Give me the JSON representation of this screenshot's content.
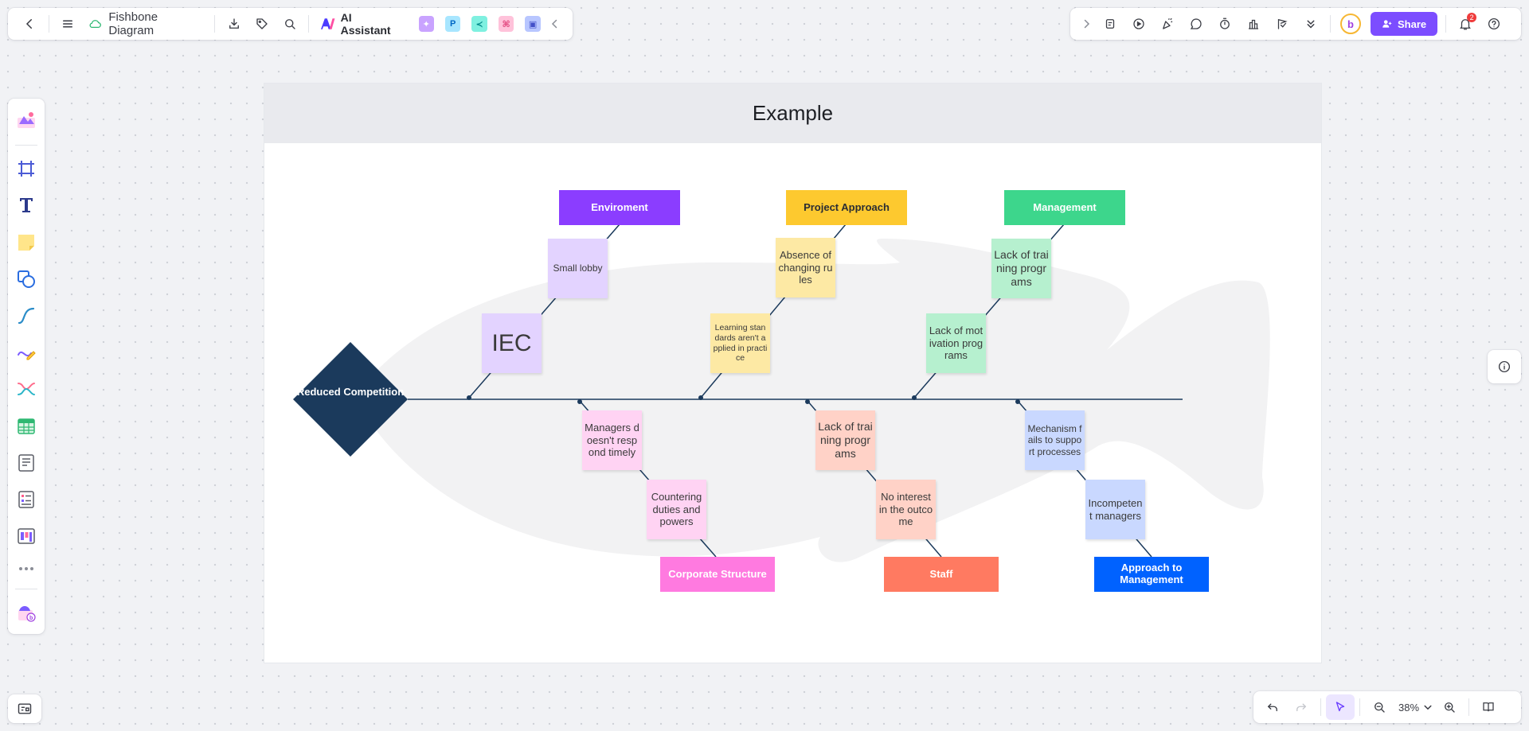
{
  "app": {
    "document_title": "Fishbone Diagram",
    "ai_assistant_label": "AI Assistant",
    "share_label": "Share",
    "notification_count": "2",
    "zoom_level": "38%",
    "accent_color": "#7c4dff"
  },
  "board": {
    "title": "Example",
    "head_label": "Reduced Competition",
    "head_color": "#1b3a5c",
    "categories_top": [
      {
        "label": "Enviroment",
        "color": "#8b3dff"
      },
      {
        "label": "Project Approach",
        "color": "#fdc92f"
      },
      {
        "label": "Management",
        "color": "#3dd68c"
      }
    ],
    "categories_bottom": [
      {
        "label": "Corporate Structure",
        "color": "#ff7ae0"
      },
      {
        "label": "Staff",
        "color": "#ff7a61"
      },
      {
        "label": "Approach to Management",
        "color": "#0062ff"
      }
    ],
    "stickies": {
      "env_1": "Small lobby",
      "env_2": "IEC",
      "proj_1": "Absence of changing rules",
      "proj_2": "Learning standards aren't applied in practice",
      "mgmt_1": "Lack of training programs",
      "mgmt_2": "Lack of motivation programs",
      "corp_1": "Managers doesn't respond timely",
      "corp_2": "Countering duties and powers",
      "staff_1": "Lack of training programs",
      "staff_2": "No interest in the outcome",
      "appr_1": "Mechanism fails to support processes",
      "appr_2": "Incompetent managers"
    }
  },
  "icons": {
    "topbar_left": [
      "back-icon",
      "menu-icon",
      "cloud-sync-icon",
      "download-icon",
      "tag-icon",
      "search-icon"
    ],
    "topbar_right": [
      "expand-icon",
      "sticker-icon",
      "play-icon",
      "celebrate-icon",
      "comment-icon",
      "timer-icon",
      "vote-icon",
      "flag-icon",
      "more-down-icon",
      "bell-icon",
      "help-icon"
    ],
    "left_toolbar": [
      "templates-icon",
      "frame-icon",
      "text-icon",
      "sticky-note-icon",
      "shape-icon",
      "connector-icon",
      "pen-icon",
      "mindmap-icon",
      "table-icon",
      "document-icon",
      "list-icon",
      "kanban-icon",
      "more-icon",
      "apps-icon"
    ]
  }
}
